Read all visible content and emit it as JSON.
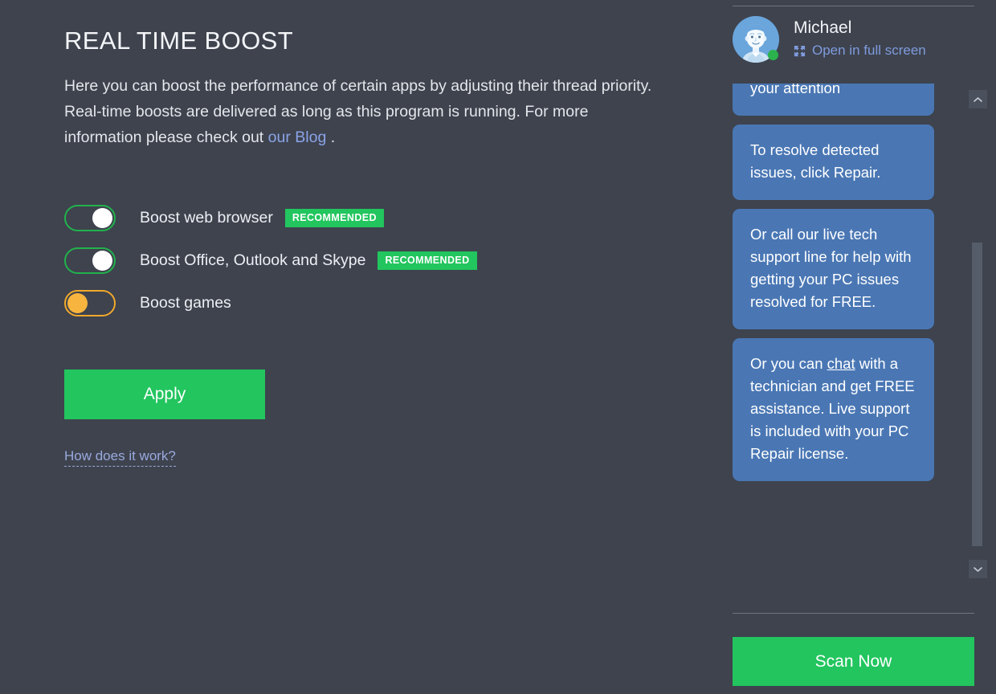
{
  "main": {
    "title": "REAL TIME BOOST",
    "description_before": "Here you can boost the performance of certain apps by adjusting their thread priority. Real-time boosts are delivered as long as this program is running. For more information please check out ",
    "description_link": "our Blog",
    "description_after": " .",
    "toggles": [
      {
        "label": "Boost web browser",
        "state": "on",
        "badge": "RECOMMENDED",
        "color": "#22b24c"
      },
      {
        "label": "Boost Office, Outlook and Skype",
        "state": "on",
        "badge": "RECOMMENDED",
        "color": "#22b24c"
      },
      {
        "label": "Boost games",
        "state": "off",
        "badge": "",
        "color": "#f0a92a"
      }
    ],
    "apply_label": "Apply",
    "how_link": "How does it work?"
  },
  "sidebar": {
    "profile": {
      "name": "Michael",
      "fullscreen_label": "Open in full screen",
      "status": "online",
      "avatar_icon": "user-avatar-illustration",
      "fullscreen_icon": "expand-fullscreen-icon"
    },
    "chat": {
      "messages": [
        {
          "text_parts": [
            {
              "text": "issues that may need your attention"
            }
          ]
        },
        {
          "text_parts": [
            {
              "text": "To resolve detected issues, click Repair."
            }
          ]
        },
        {
          "text_parts": [
            {
              "text": "Or call our live tech support line for help with getting your PC issues resolved for FREE."
            }
          ]
        },
        {
          "text_parts": [
            {
              "text": "Or you can "
            },
            {
              "text": "chat",
              "underline": true
            },
            {
              "text": " with a technician and get FREE assistance. Live support is included with your PC Repair license."
            }
          ]
        }
      ],
      "scroll_up_icon": "chevron-up-icon",
      "scroll_down_icon": "chevron-down-icon"
    },
    "scan_label": "Scan Now"
  },
  "colors": {
    "background": "#3e434e",
    "accent_green": "#22c55e",
    "toggle_on": "#22b24c",
    "toggle_off": "#f0a92a",
    "bubble_blue": "#4a77b4",
    "link_blue": "#8ba4e8"
  }
}
